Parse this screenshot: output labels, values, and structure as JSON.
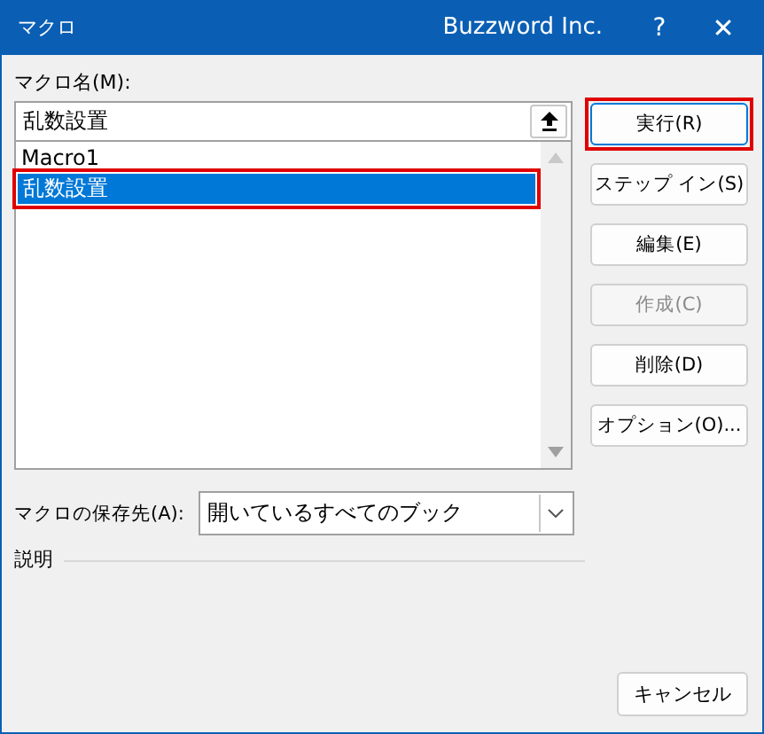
{
  "window": {
    "title": "マクロ",
    "brand": "Buzzword Inc.",
    "help": "?",
    "close": "✕"
  },
  "macro_name": {
    "label": "マクロ名(M):",
    "value": "乱数設置"
  },
  "macros": [
    {
      "name": "Macro1",
      "selected": false,
      "highlighted": false
    },
    {
      "name": "乱数設置",
      "selected": true,
      "highlighted": true
    }
  ],
  "buttons": [
    {
      "label": "実行(R)",
      "disabled": false,
      "highlighted": true
    },
    {
      "label": "ステップ イン(S)",
      "disabled": false,
      "highlighted": false
    },
    {
      "label": "編集(E)",
      "disabled": false,
      "highlighted": false
    },
    {
      "label": "作成(C)",
      "disabled": true,
      "highlighted": false
    },
    {
      "label": "削除(D)",
      "disabled": false,
      "highlighted": false
    },
    {
      "label": "オプション(O)...",
      "disabled": false,
      "highlighted": false
    }
  ],
  "location": {
    "label": "マクロの保存先(A):",
    "value": "開いているすべてのブック"
  },
  "description": {
    "label": "説明"
  },
  "cancel": "キャンセル"
}
